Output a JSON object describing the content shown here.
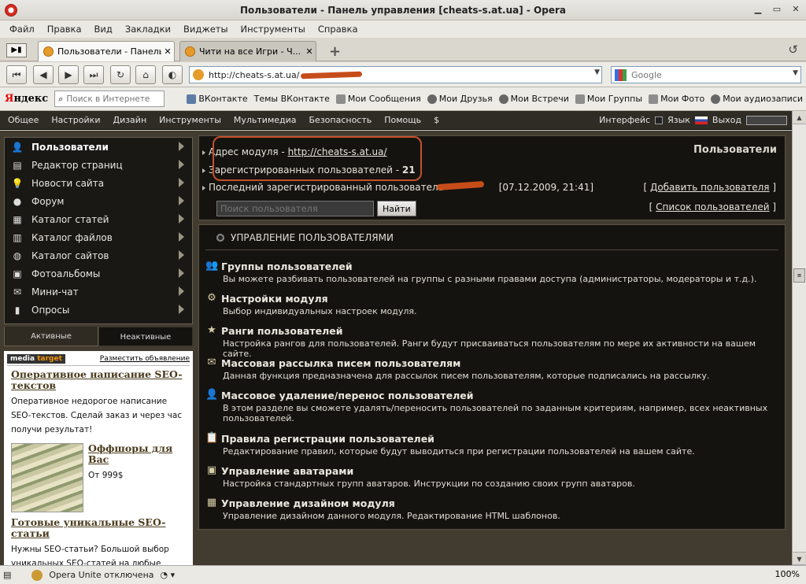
{
  "window": {
    "title": "Пользователи - Панель управления [cheats-s.at.ua] - Opera"
  },
  "menu": [
    "Файл",
    "Правка",
    "Вид",
    "Закладки",
    "Виджеты",
    "Инструменты",
    "Справка"
  ],
  "tabs": [
    {
      "label": "Пользователи - Панель...",
      "close": "✕"
    },
    {
      "label": "Чити на все Игри - Ч...",
      "close": "✕"
    }
  ],
  "address": {
    "url": "http://cheats-s.at.ua/",
    "search_placeholder": "Google"
  },
  "yandex": {
    "logo_first": "Я",
    "logo_rest": "ндекс",
    "search_placeholder": "Поиск в Интернете",
    "links": [
      "ВКонтакте",
      "Темы ВКонтакте",
      "Мои Сообщения",
      "Мои Друзья",
      "Мои Встречи",
      "Мои Группы",
      "Мои Фото",
      "Мои аудиозаписи"
    ]
  },
  "panel_menu": [
    "Общее",
    "Настройки",
    "Дизайн",
    "Инструменты",
    "Мультимедиа",
    "Безопасность",
    "Помощь",
    "$"
  ],
  "panel_right": {
    "interface": "Интерфейс",
    "lang": "Язык",
    "logout": "Выход"
  },
  "sidebar": [
    {
      "label": "Пользователи",
      "icon": "users-icon",
      "glyph": "👤"
    },
    {
      "label": "Редактор страниц",
      "icon": "pages-icon",
      "glyph": "▤"
    },
    {
      "label": "Новости сайта",
      "icon": "bulb-icon",
      "glyph": "💡"
    },
    {
      "label": "Форум",
      "icon": "forum-icon",
      "glyph": "●"
    },
    {
      "label": "Каталог статей",
      "icon": "articles-icon",
      "glyph": "▦"
    },
    {
      "label": "Каталог файлов",
      "icon": "files-icon",
      "glyph": "▥"
    },
    {
      "label": "Каталог сайтов",
      "icon": "globe-icon",
      "glyph": "◍"
    },
    {
      "label": "Фотоальбомы",
      "icon": "camera-icon",
      "glyph": "▣"
    },
    {
      "label": "Мини-чат",
      "icon": "chat-icon",
      "glyph": "✉"
    },
    {
      "label": "Опросы",
      "icon": "poll-icon",
      "glyph": "▮"
    }
  ],
  "sidebar_tabs": {
    "active": "Активные",
    "inactive": "Неактивные"
  },
  "ad": {
    "brand_a": "media",
    "brand_b": "target",
    "place": "Разместить объявление",
    "h1": "Оперативное написание SEO-текстов",
    "p1": "Оперативное недорогое написание SEO-текстов. Сделай заказ и через час получи результат!",
    "h2": "Оффшоры для Вас",
    "p2": "От 999$",
    "h3": "Готовые уникальные SEO-статьи",
    "p3": "Нужны SEO-статьи? Большой выбор уникальных SEO-статей на любые тематики! Быстро и качественно!"
  },
  "main": {
    "title": "Пользователи",
    "module_addr_label": "Адрес модуля - ",
    "module_addr": "http://cheats-s.at.ua/",
    "registered_label": "Зарегистрированных пользователей - ",
    "registered_count": "21",
    "last_user_label": "Последний зарегистрированный пользователь - ",
    "last_user_date": "[07.12.2009, 21:41]",
    "add_user": "Добавить пользователя",
    "user_list": "Список пользователей",
    "search_placeholder": "Поиск пользователя",
    "search_button": "Найти"
  },
  "mgmt": {
    "heading": "УПРАВЛЕНИЕ ПОЛЬЗОВАТЕЛЯМИ",
    "sections": [
      {
        "title": "Группы пользователей",
        "desc": "Вы можете разбивать пользователей на группы с разными правами доступа (администраторы, модераторы и т.д.).",
        "glyph": "👥"
      },
      {
        "title": "Настройки модуля",
        "desc": "Выбор индивидуальных настроек модуля.",
        "glyph": "⚙"
      },
      {
        "title": "Ранги пользователей",
        "desc": "Настройка рангов для пользователей. Ранги будут присваиваться пользователям по мере их активности на вашем сайте.",
        "glyph": "★"
      },
      {
        "title": "Массовая рассылка писем пользователям",
        "desc": "Данная функция предназначена для рассылок писем пользователям, которые подписались на рассылку.",
        "glyph": "✉"
      },
      {
        "title": "Массовое удаление/перенос пользователей",
        "desc": "В этом разделе вы сможете удалять/переносить пользователей по заданным критериям, например, всех неактивных пользователей.",
        "glyph": "👤"
      },
      {
        "title": "Правила регистрации пользователей",
        "desc": "Редактирование правил, которые будут выводиться при регистрации пользователей на вашем сайте.",
        "glyph": "📋"
      },
      {
        "title": "Управление аватарами",
        "desc": "Настройка стандартных групп аватаров. Инструкции по созданию своих групп аватаров.",
        "glyph": "▣"
      },
      {
        "title": "Управление дизайном модуля",
        "desc": "Управление дизайном данного модуля. Редактирование HTML шаблонов.",
        "glyph": "▦"
      }
    ]
  },
  "status": {
    "unite": "Opera Unite отключена",
    "zoom": "100%"
  }
}
